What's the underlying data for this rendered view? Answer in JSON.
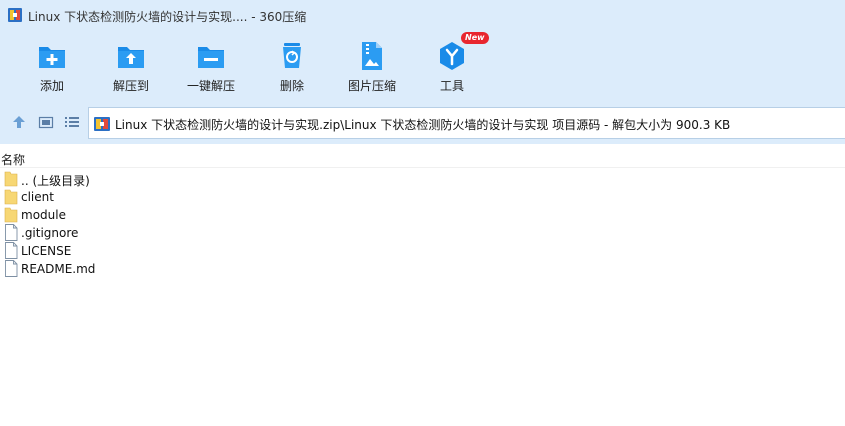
{
  "window": {
    "title": "Linux 下状态检测防火墙的设计与实现.... - 360压缩"
  },
  "toolbar": {
    "items": [
      {
        "label": "添加",
        "icon": "add-icon"
      },
      {
        "label": "解压到",
        "icon": "extract-to-icon"
      },
      {
        "label": "一键解压",
        "icon": "one-click-extract-icon"
      },
      {
        "label": "删除",
        "icon": "delete-icon"
      },
      {
        "label": "图片压缩",
        "icon": "image-compress-icon"
      },
      {
        "label": "工具",
        "icon": "tools-icon",
        "badge": "New"
      }
    ]
  },
  "address": {
    "path": "Linux 下状态检测防火墙的设计与实现.zip\\Linux 下状态检测防火墙的设计与实现 项目源码 - 解包大小为 900.3 KB"
  },
  "list": {
    "column_name": "名称",
    "rows": [
      {
        "name": ".. (上级目录)",
        "type": "folder"
      },
      {
        "name": "client",
        "type": "folder"
      },
      {
        "name": "module",
        "type": "folder"
      },
      {
        "name": ".gitignore",
        "type": "file"
      },
      {
        "name": "LICENSE",
        "type": "file"
      },
      {
        "name": "README.md",
        "type": "file"
      }
    ]
  },
  "colors": {
    "chrome_bg": "#dcecfb",
    "icon_blue": "#1a8be8",
    "badge_red": "#e8262f",
    "folder_yellow": "#f7d774"
  }
}
